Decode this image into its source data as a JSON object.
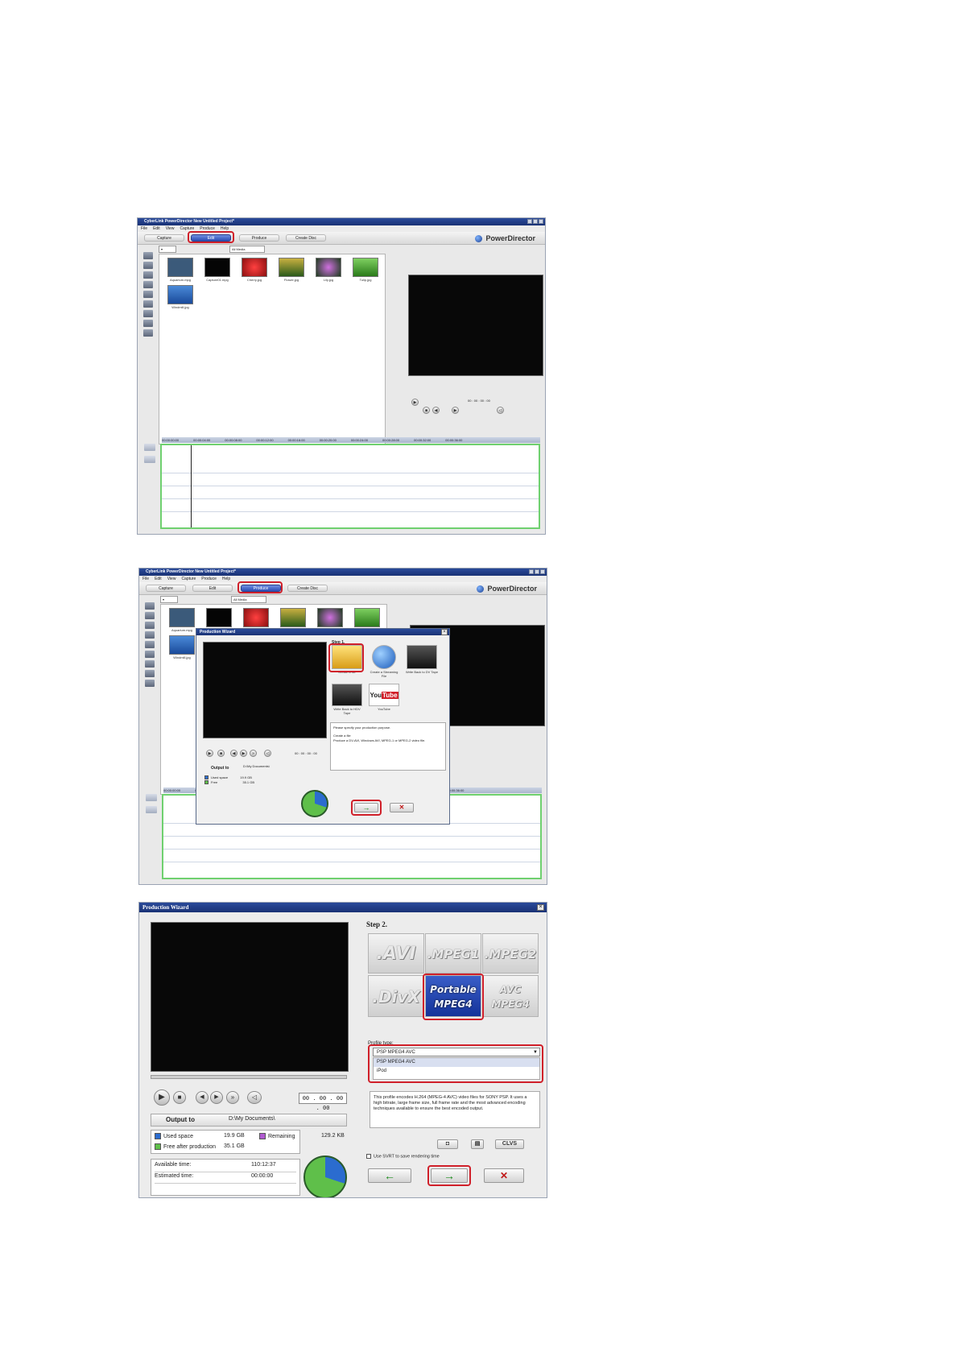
{
  "app": {
    "window_title": "CyberLink PowerDirector New Untitled Project*",
    "menu": [
      "File",
      "Edit",
      "View",
      "Capture",
      "Produce",
      "Help"
    ],
    "tabs": [
      "Capture",
      "Edit",
      "Produce",
      "Create Disc"
    ],
    "logo": "PowerDirector",
    "library_filter": "All Media",
    "media": [
      {
        "name": "Aquarium.mpg",
        "color": "#3b5a7a"
      },
      {
        "name": "Capture01.mpg",
        "color": "#050505"
      },
      {
        "name": "Cherry.jpg",
        "color": "#c8201e"
      },
      {
        "name": "Flower.jpg",
        "color": "#6e8a2a"
      },
      {
        "name": "Lily.jpg",
        "color": "#6a3a8e"
      },
      {
        "name": "Tulip.jpg",
        "color": "#4aa53a"
      },
      {
        "name": "Windmill.jpg",
        "color": "#3a7bc8"
      }
    ],
    "timecode": "00 : 00 : 00 : 00",
    "ruler_marks": [
      "00:00:00:00",
      "00:00:04:00",
      "00:00:08:00",
      "00:00:12:00",
      "00:00:16:00",
      "00:00:20:00",
      "00:00:24:00",
      "00:00:28:00",
      "00:00:32:00",
      "00:00:36:00"
    ]
  },
  "wizard_step1": {
    "title": "Production Wizard",
    "step": "Step 1.",
    "options": [
      {
        "label": "Create a file"
      },
      {
        "label": "Create a Streaming File"
      },
      {
        "label": "Write Back to DV Tape"
      },
      {
        "label": "Write Back to HDV Tape"
      },
      {
        "label": "YouTube"
      }
    ],
    "prompt": "Please specify your production purpose.",
    "desc_title": "Create a file",
    "desc_text": "Produce a DV-AVI, Windows AVI, MPEG-1 or MPEG-2 video file.",
    "output_to_label": "Output to",
    "output_path": "D:\\My Documents\\",
    "used_space_label": "Used space",
    "used_space": "19.9 GB",
    "free_label": "Free",
    "free": "35.1 GB",
    "timecode": "00 : 00 : 00 : 00"
  },
  "wizard_step2": {
    "title": "Production Wizard",
    "step": "Step 2.",
    "formats": [
      ".AVI",
      ".MPEG1",
      ".MPEG2",
      ".DivX",
      "Portable MPEG4",
      "AVC MPEG4"
    ],
    "profile_type_label": "Profile type:",
    "profile_selected": "PSP MPEG4 AVC",
    "profile_options": [
      "PSP MPEG4 AVC",
      "iPod"
    ],
    "profile_description": "This profile encodes H.264 (MPEG-4 AVC) video files for SONY PSP. It uses a high bitrate, large frame size, full frame rate and the most advanced encoding techniques available to ensure the best encoded output.",
    "clvs_label": "CLVS",
    "svrt_label": "Use SVRT to save rendering time",
    "timecode": "00 . 00 . 00 . 00",
    "output_to_label": "Output to",
    "output_path": "D:\\My Documents\\",
    "used_space_label": "Used space",
    "used_space": "19.9 GB",
    "remaining_label": "Remaining",
    "remaining": "129.2 KB",
    "free_after_label": "Free after production",
    "free_after": "35.1 GB",
    "available_time_label": "Available time:",
    "available_time": "110:12:37",
    "estimated_time_label": "Estimated time:",
    "estimated_time": "00:00:00",
    "colors": {
      "used": "#2b6ccf",
      "free": "#5fbf4a",
      "remaining": "#b05ad0"
    }
  }
}
